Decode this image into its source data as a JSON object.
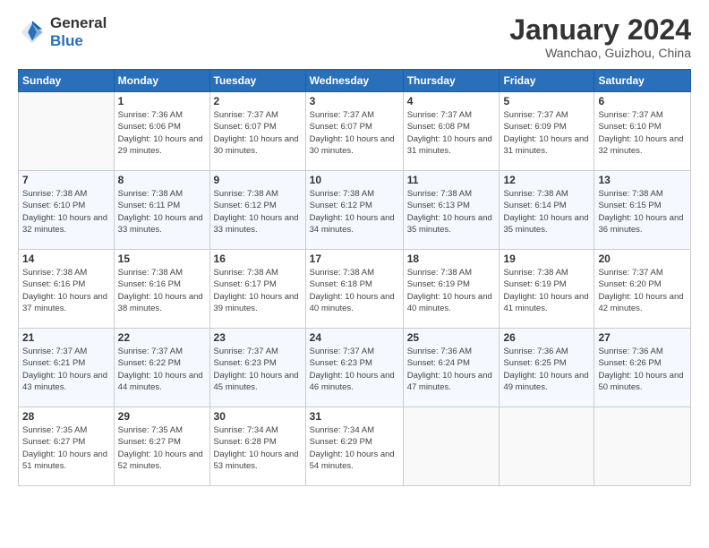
{
  "header": {
    "logo_line1": "General",
    "logo_line2": "Blue",
    "month": "January 2024",
    "location": "Wanchao, Guizhou, China"
  },
  "days_of_week": [
    "Sunday",
    "Monday",
    "Tuesday",
    "Wednesday",
    "Thursday",
    "Friday",
    "Saturday"
  ],
  "weeks": [
    [
      {
        "day": "",
        "sunrise": "",
        "sunset": "",
        "daylight": ""
      },
      {
        "day": "1",
        "sunrise": "Sunrise: 7:36 AM",
        "sunset": "Sunset: 6:06 PM",
        "daylight": "Daylight: 10 hours and 29 minutes."
      },
      {
        "day": "2",
        "sunrise": "Sunrise: 7:37 AM",
        "sunset": "Sunset: 6:07 PM",
        "daylight": "Daylight: 10 hours and 30 minutes."
      },
      {
        "day": "3",
        "sunrise": "Sunrise: 7:37 AM",
        "sunset": "Sunset: 6:07 PM",
        "daylight": "Daylight: 10 hours and 30 minutes."
      },
      {
        "day": "4",
        "sunrise": "Sunrise: 7:37 AM",
        "sunset": "Sunset: 6:08 PM",
        "daylight": "Daylight: 10 hours and 31 minutes."
      },
      {
        "day": "5",
        "sunrise": "Sunrise: 7:37 AM",
        "sunset": "Sunset: 6:09 PM",
        "daylight": "Daylight: 10 hours and 31 minutes."
      },
      {
        "day": "6",
        "sunrise": "Sunrise: 7:37 AM",
        "sunset": "Sunset: 6:10 PM",
        "daylight": "Daylight: 10 hours and 32 minutes."
      }
    ],
    [
      {
        "day": "7",
        "sunrise": "Sunrise: 7:38 AM",
        "sunset": "Sunset: 6:10 PM",
        "daylight": "Daylight: 10 hours and 32 minutes."
      },
      {
        "day": "8",
        "sunrise": "Sunrise: 7:38 AM",
        "sunset": "Sunset: 6:11 PM",
        "daylight": "Daylight: 10 hours and 33 minutes."
      },
      {
        "day": "9",
        "sunrise": "Sunrise: 7:38 AM",
        "sunset": "Sunset: 6:12 PM",
        "daylight": "Daylight: 10 hours and 33 minutes."
      },
      {
        "day": "10",
        "sunrise": "Sunrise: 7:38 AM",
        "sunset": "Sunset: 6:12 PM",
        "daylight": "Daylight: 10 hours and 34 minutes."
      },
      {
        "day": "11",
        "sunrise": "Sunrise: 7:38 AM",
        "sunset": "Sunset: 6:13 PM",
        "daylight": "Daylight: 10 hours and 35 minutes."
      },
      {
        "day": "12",
        "sunrise": "Sunrise: 7:38 AM",
        "sunset": "Sunset: 6:14 PM",
        "daylight": "Daylight: 10 hours and 35 minutes."
      },
      {
        "day": "13",
        "sunrise": "Sunrise: 7:38 AM",
        "sunset": "Sunset: 6:15 PM",
        "daylight": "Daylight: 10 hours and 36 minutes."
      }
    ],
    [
      {
        "day": "14",
        "sunrise": "Sunrise: 7:38 AM",
        "sunset": "Sunset: 6:16 PM",
        "daylight": "Daylight: 10 hours and 37 minutes."
      },
      {
        "day": "15",
        "sunrise": "Sunrise: 7:38 AM",
        "sunset": "Sunset: 6:16 PM",
        "daylight": "Daylight: 10 hours and 38 minutes."
      },
      {
        "day": "16",
        "sunrise": "Sunrise: 7:38 AM",
        "sunset": "Sunset: 6:17 PM",
        "daylight": "Daylight: 10 hours and 39 minutes."
      },
      {
        "day": "17",
        "sunrise": "Sunrise: 7:38 AM",
        "sunset": "Sunset: 6:18 PM",
        "daylight": "Daylight: 10 hours and 40 minutes."
      },
      {
        "day": "18",
        "sunrise": "Sunrise: 7:38 AM",
        "sunset": "Sunset: 6:19 PM",
        "daylight": "Daylight: 10 hours and 40 minutes."
      },
      {
        "day": "19",
        "sunrise": "Sunrise: 7:38 AM",
        "sunset": "Sunset: 6:19 PM",
        "daylight": "Daylight: 10 hours and 41 minutes."
      },
      {
        "day": "20",
        "sunrise": "Sunrise: 7:37 AM",
        "sunset": "Sunset: 6:20 PM",
        "daylight": "Daylight: 10 hours and 42 minutes."
      }
    ],
    [
      {
        "day": "21",
        "sunrise": "Sunrise: 7:37 AM",
        "sunset": "Sunset: 6:21 PM",
        "daylight": "Daylight: 10 hours and 43 minutes."
      },
      {
        "day": "22",
        "sunrise": "Sunrise: 7:37 AM",
        "sunset": "Sunset: 6:22 PM",
        "daylight": "Daylight: 10 hours and 44 minutes."
      },
      {
        "day": "23",
        "sunrise": "Sunrise: 7:37 AM",
        "sunset": "Sunset: 6:23 PM",
        "daylight": "Daylight: 10 hours and 45 minutes."
      },
      {
        "day": "24",
        "sunrise": "Sunrise: 7:37 AM",
        "sunset": "Sunset: 6:23 PM",
        "daylight": "Daylight: 10 hours and 46 minutes."
      },
      {
        "day": "25",
        "sunrise": "Sunrise: 7:36 AM",
        "sunset": "Sunset: 6:24 PM",
        "daylight": "Daylight: 10 hours and 47 minutes."
      },
      {
        "day": "26",
        "sunrise": "Sunrise: 7:36 AM",
        "sunset": "Sunset: 6:25 PM",
        "daylight": "Daylight: 10 hours and 49 minutes."
      },
      {
        "day": "27",
        "sunrise": "Sunrise: 7:36 AM",
        "sunset": "Sunset: 6:26 PM",
        "daylight": "Daylight: 10 hours and 50 minutes."
      }
    ],
    [
      {
        "day": "28",
        "sunrise": "Sunrise: 7:35 AM",
        "sunset": "Sunset: 6:27 PM",
        "daylight": "Daylight: 10 hours and 51 minutes."
      },
      {
        "day": "29",
        "sunrise": "Sunrise: 7:35 AM",
        "sunset": "Sunset: 6:27 PM",
        "daylight": "Daylight: 10 hours and 52 minutes."
      },
      {
        "day": "30",
        "sunrise": "Sunrise: 7:34 AM",
        "sunset": "Sunset: 6:28 PM",
        "daylight": "Daylight: 10 hours and 53 minutes."
      },
      {
        "day": "31",
        "sunrise": "Sunrise: 7:34 AM",
        "sunset": "Sunset: 6:29 PM",
        "daylight": "Daylight: 10 hours and 54 minutes."
      },
      {
        "day": "",
        "sunrise": "",
        "sunset": "",
        "daylight": ""
      },
      {
        "day": "",
        "sunrise": "",
        "sunset": "",
        "daylight": ""
      },
      {
        "day": "",
        "sunrise": "",
        "sunset": "",
        "daylight": ""
      }
    ]
  ]
}
